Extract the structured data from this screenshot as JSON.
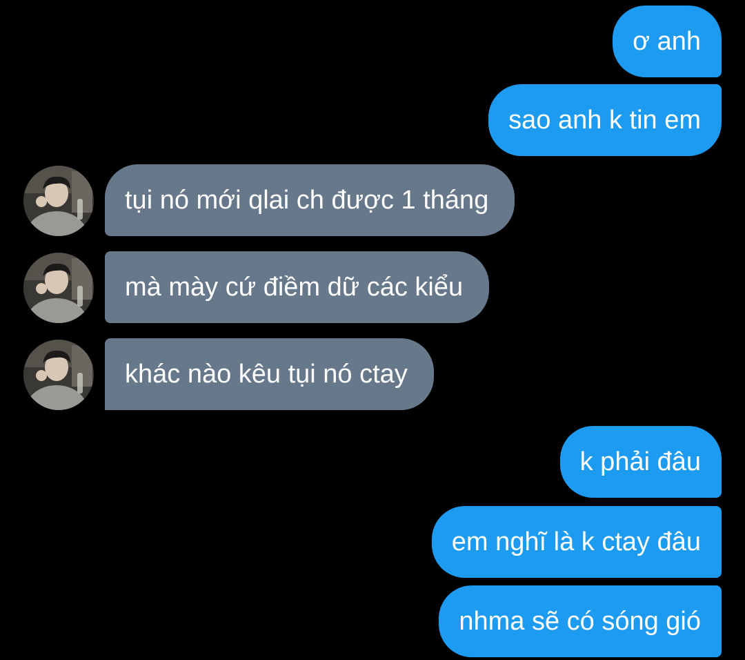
{
  "conversation": {
    "messages": [
      {
        "sender": "me",
        "text": "ơ anh"
      },
      {
        "sender": "me",
        "text": "sao anh k tin em"
      },
      {
        "sender": "them",
        "text": "tụi nó mới qlai ch được 1 tháng"
      },
      {
        "sender": "them",
        "text": "mà mày cứ điềm dữ các kiểu"
      },
      {
        "sender": "them",
        "text": "khác nào kêu tụi nó ctay"
      },
      {
        "sender": "me",
        "text": "k phải đâu"
      },
      {
        "sender": "me",
        "text": "em nghĩ là k ctay đâu"
      },
      {
        "sender": "me",
        "text": "nhma sẽ có sóng gió"
      }
    ]
  },
  "colors": {
    "background": "#000000",
    "sent_bubble": "#1d9bf0",
    "received_bubble": "#66788a",
    "text": "#ffffff"
  },
  "icons": {
    "contact_avatar": "contact-avatar-photo"
  }
}
